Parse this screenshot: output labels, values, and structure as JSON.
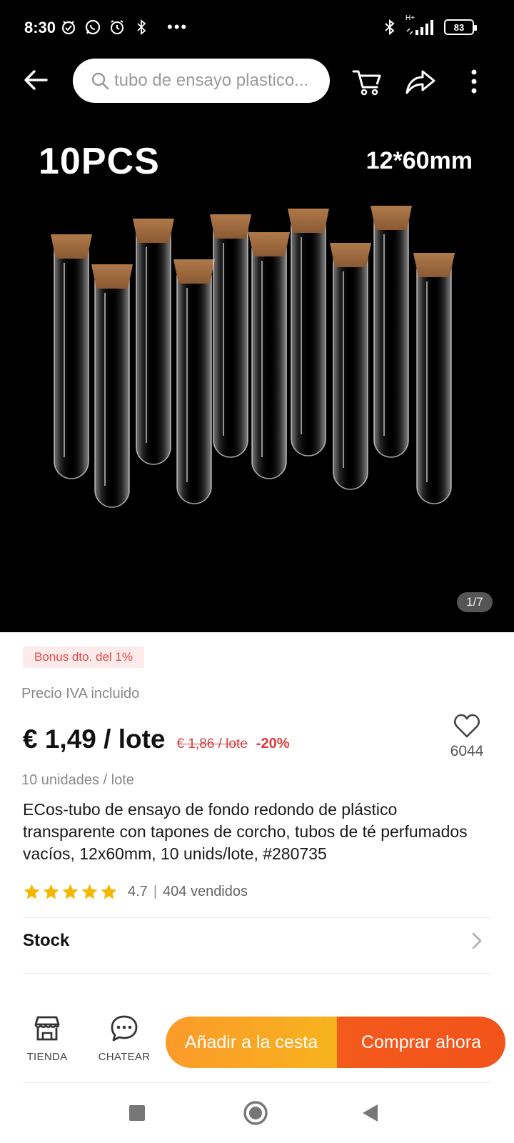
{
  "status_bar": {
    "time": "8:30",
    "network_label": "H+",
    "battery": "83"
  },
  "search": {
    "query": "tubo de ensayo plastico..."
  },
  "gallery": {
    "label_left": "10PCS",
    "label_right": "12*60mm",
    "counter": "1/7"
  },
  "product": {
    "bonus_badge": "Bonus dto. del 1%",
    "price_note": "Precio IVA incluido",
    "price_current": "€ 1,49 / lote",
    "price_old": "€ 1,86 / lote",
    "discount": "-20%",
    "wishlist_count": "6044",
    "unit_note": "10 unidades / lote",
    "title": "ECos-tubo de ensayo de fondo redondo de plástico transparente con tapones de corcho, tubos de té perfumados vacíos, 12x60mm, 10 unids/lote, #280735",
    "rating": "4.7",
    "rating_separator": "|",
    "sold": "404 vendidos",
    "stars": 5
  },
  "sections": {
    "stock_label": "Stock"
  },
  "action_bar": {
    "store_label": "TIENDA",
    "chat_label": "CHATEAR",
    "add_to_cart": "Añadir a la cesta",
    "buy_now": "Comprar ahora"
  },
  "colors": {
    "cart_button": "#f9a624",
    "buy_button": "#f3561b",
    "discount": "#e03a3a",
    "star": "#f5b700",
    "badge_bg": "#fdeaea"
  }
}
